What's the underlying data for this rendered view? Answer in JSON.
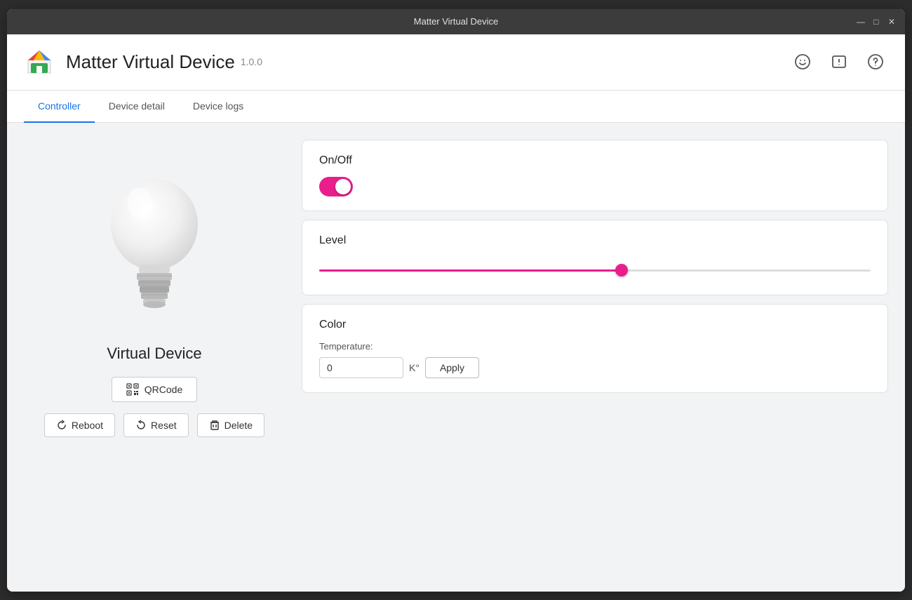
{
  "titleBar": {
    "title": "Matter Virtual Device",
    "controls": {
      "minimize": "—",
      "maximize": "□",
      "close": "✕"
    }
  },
  "header": {
    "appTitle": "Matter Virtual Device",
    "version": "1.0.0",
    "icons": {
      "emoji": "☺",
      "alert": "⚠",
      "help": "?"
    }
  },
  "tabs": [
    {
      "id": "controller",
      "label": "Controller",
      "active": true
    },
    {
      "id": "device-detail",
      "label": "Device detail",
      "active": false
    },
    {
      "id": "device-logs",
      "label": "Device logs",
      "active": false
    }
  ],
  "leftPanel": {
    "deviceName": "Virtual Device",
    "qrcodeLabel": "QRCode",
    "buttons": {
      "reboot": "Reboot",
      "reset": "Reset",
      "delete": "Delete"
    }
  },
  "rightPanel": {
    "onOff": {
      "title": "On/Off",
      "toggled": true
    },
    "level": {
      "title": "Level",
      "value": 55,
      "min": 0,
      "max": 100
    },
    "color": {
      "title": "Color",
      "temperatureLabel": "Temperature:",
      "temperatureValue": "0",
      "temperatureUnit": "K°",
      "applyLabel": "Apply"
    }
  }
}
